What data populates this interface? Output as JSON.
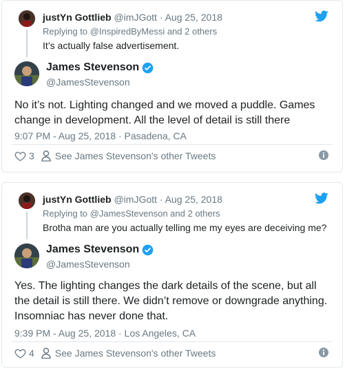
{
  "tweets": [
    {
      "reply": {
        "name": "justYn Gottlieb",
        "handle": "@imJGott",
        "dot": "·",
        "date": "Aug 25, 2018",
        "replying_to": "Replying to @InspiredByMessi and 2 others",
        "text": "It’s actually false advertisement."
      },
      "author": {
        "name": "James Stevenson",
        "handle": "@JamesStevenson",
        "verified_icon": "verified-badge-icon"
      },
      "body_lines": [
        "No it’s not. Lighting changed and we moved a puddle. Games",
        "change in development. All the level of detail is still there"
      ],
      "timestamp": "9:07 PM - Aug 25, 2018 · Pasadena, CA",
      "likes": "3",
      "see_other": "See James Stevenson's other Tweets"
    },
    {
      "reply": {
        "name": "justYn Gottlieb",
        "handle": "@imJGott",
        "dot": "·",
        "date": "Aug 25, 2018",
        "replying_to": "Replying to @JamesStevenson and 2 others",
        "text": "Brotha man are you actually telling me my eyes are deceiving me?"
      },
      "author": {
        "name": "James Stevenson",
        "handle": "@JamesStevenson",
        "verified_icon": "verified-badge-icon"
      },
      "body_lines": [
        "Yes. The lighting changes the dark details of the scene, but all",
        "the detail is still there. We didn’t remove or downgrade anything.",
        "Insomniac has never done that."
      ],
      "timestamp": "9:39 PM - Aug 25, 2018 · Los Angeles, CA",
      "likes": "4",
      "see_other": "See James Stevenson's other Tweets"
    }
  ],
  "colors": {
    "twitter_blue": "#1da1f2",
    "verified_blue": "#1da1f2",
    "meta_gray": "#697882",
    "border": "#e1e8ed"
  }
}
